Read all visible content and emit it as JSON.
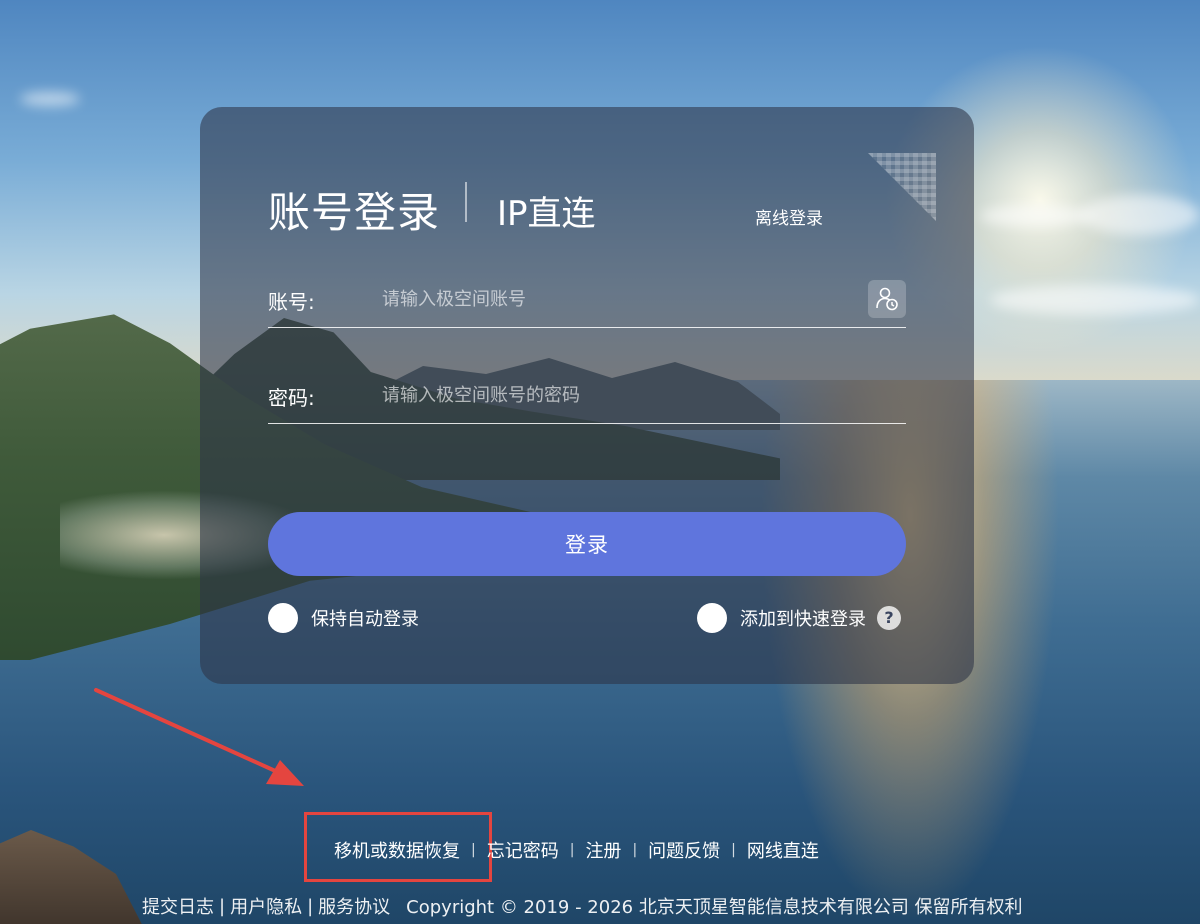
{
  "login": {
    "tab_account": "账号登录",
    "tab_ip": "IP直连",
    "offline_login": "离线登录",
    "account_label": "账号:",
    "account_placeholder": "请输入极空间账号",
    "password_label": "密码:",
    "password_placeholder": "请输入极空间账号的密码",
    "submit_label": "登录",
    "auto_login_label": "保持自动登录",
    "quick_login_label": "添加到快速登录",
    "help_glyph": "?"
  },
  "footer": {
    "links": [
      "移机或数据恢复",
      "忘记密码",
      "注册",
      "问题反馈",
      "网线直连"
    ],
    "separator": "|",
    "legal_links": [
      "提交日志",
      "用户隐私",
      "服务协议"
    ],
    "copyright": "Copyright © 2019 - 2026 北京天顶星智能信息技术有限公司 保留所有权利"
  },
  "colors": {
    "accent": "#5f75dd",
    "annotation": "#e4453f"
  },
  "icons": {
    "qr_corner": "qr-code-icon",
    "account_picker": "user-clock-icon",
    "help": "question-mark-icon"
  }
}
